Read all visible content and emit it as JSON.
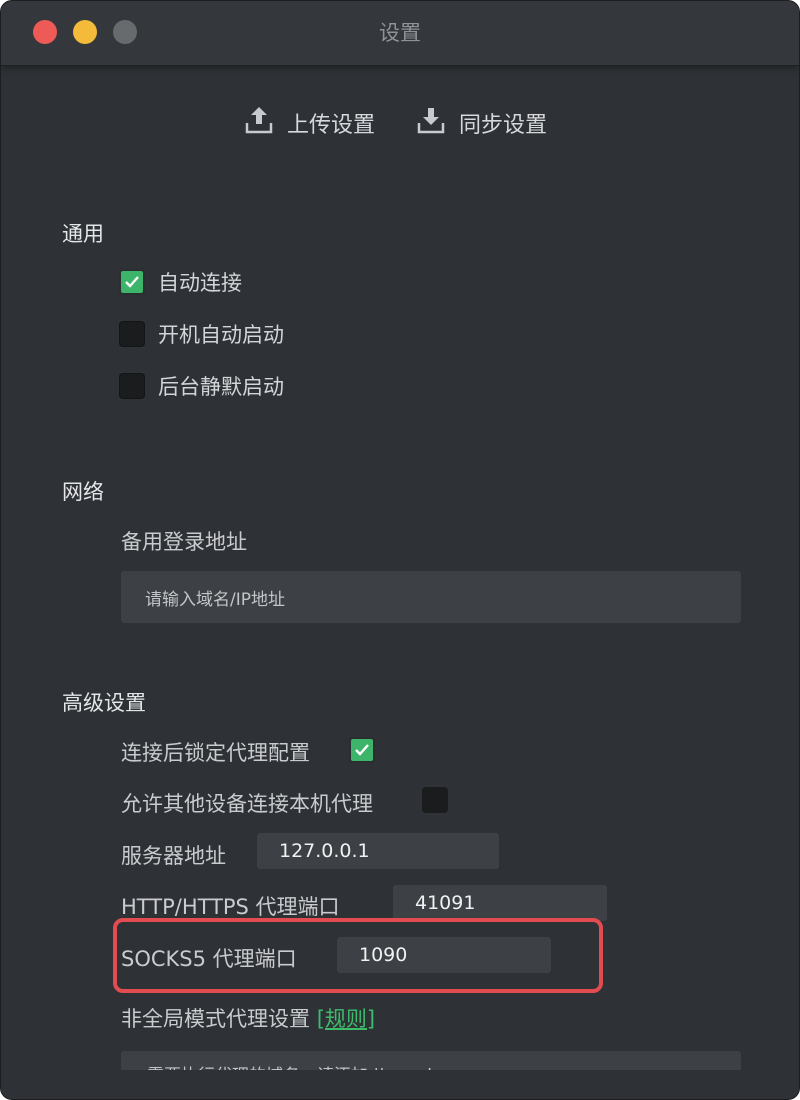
{
  "window": {
    "title": "设置"
  },
  "toolbar": {
    "upload_label": "上传设置",
    "upload_icon": "upload-icon",
    "sync_label": "同步设置",
    "sync_icon": "download-icon"
  },
  "general": {
    "title": "通用",
    "options": [
      {
        "label": "自动连接",
        "checked": true
      },
      {
        "label": "开机自动启动",
        "checked": false
      },
      {
        "label": "后台静默启动",
        "checked": false
      }
    ]
  },
  "network": {
    "title": "网络",
    "backup_login_label": "备用登录地址",
    "backup_login_placeholder": "请输入域名/IP地址"
  },
  "advanced": {
    "title": "高级设置",
    "lock_proxy_label": "连接后锁定代理配置",
    "lock_proxy_checked": true,
    "allow_devices_label": "允许其他设备连接本机代理",
    "allow_devices_checked": false,
    "server_address_label": "服务器地址",
    "server_address_value": "127.0.0.1",
    "http_port_label": "HTTP/HTTPS 代理端口",
    "http_port_value": "41091",
    "socks_port_label": "SOCKS5 代理端口",
    "socks_port_value": "1090",
    "non_global_label": "非全局模式代理设置",
    "rule_link_label": "[规则]",
    "domains_placeholder": "需要执行代理的域名，请添加 ||google.com"
  },
  "colors": {
    "window_bg": "#2e3135",
    "accent_green": "#3cb46a",
    "highlight_red": "#e24b4f"
  }
}
